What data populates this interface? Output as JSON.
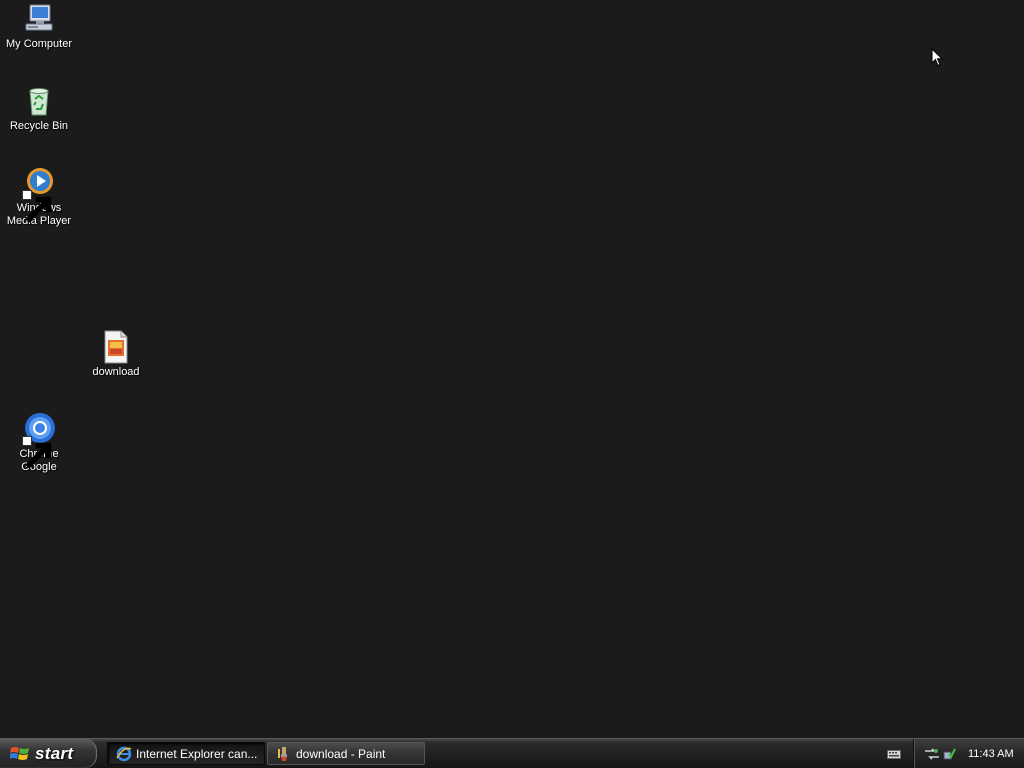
{
  "desktop": {
    "icons": [
      {
        "label": "My Computer",
        "icon": "my-computer-icon"
      },
      {
        "label": "Recycle Bin",
        "icon": "recycle-bin-icon"
      },
      {
        "label": "Windows Media Player",
        "icon": "media-player-icon"
      },
      {
        "label": "download",
        "icon": "image-file-icon"
      },
      {
        "label": "Chrome Google",
        "icon": "chrome-icon"
      }
    ]
  },
  "taskbar": {
    "start_label": "start",
    "tasks": [
      {
        "label": "Internet Explorer can...",
        "icon": "internet-explorer-icon",
        "state": "active"
      },
      {
        "label": "download - Paint",
        "icon": "paint-icon",
        "state": "inactive"
      }
    ],
    "tray": {
      "clock": "11:43 AM",
      "icons": [
        "network-icon",
        "safely-remove-hardware-icon",
        "keyboard-icon"
      ]
    }
  },
  "colors": {
    "desktop_background": "#1b1b1b",
    "taskbar": "#1f1f1f"
  }
}
